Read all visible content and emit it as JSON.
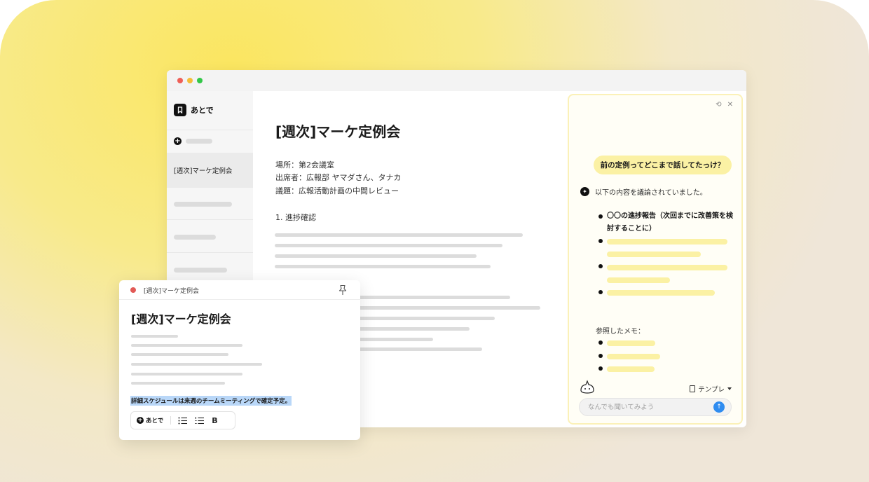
{
  "app": {
    "brand_name": "あとで",
    "icons": {
      "brand": "bookmark-icon",
      "new": "plus-circle-icon"
    }
  },
  "sidebar": {
    "active_item": "[週次]マーケ定例会"
  },
  "document": {
    "title": "[週次]マーケ定例会",
    "meta": [
      "場所：第2会議室",
      "出席者：広報部 ヤマダさん、タナカ",
      "議題：広報活動計画の中間レビュー"
    ],
    "section_heading": "1. 進捗確認"
  },
  "ai_panel": {
    "question": "前の定例ってどこまで話してたっけ？",
    "answer_intro": "以下の内容を議論されていました。",
    "answer_item_1": "〇〇の進捗報告（次回までに改善策を検討することに）",
    "reference_label": "参照したメモ：",
    "template_label": "テンプレ",
    "input_placeholder": "なんでも聞いてみよう",
    "icons": {
      "refresh": "refresh-icon",
      "close": "close-icon",
      "send": "arrow-up-icon"
    },
    "accent_color": "#fbf1a4",
    "send_color": "#2f8cf0"
  },
  "note": {
    "header_title": "[週次]マーケ定例会",
    "title": "[週次]マーケ定例会",
    "selected_text": "詳細スケジュールは来週のチームミーティングで確定予定。",
    "toolbar": {
      "later_label": "あとで",
      "bold_label": "B"
    },
    "status_color": "#e25a56"
  }
}
